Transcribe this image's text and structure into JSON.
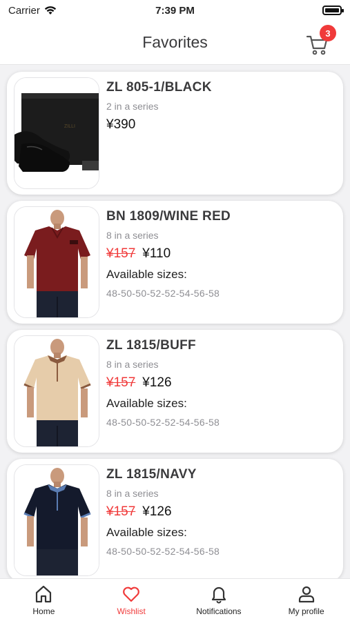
{
  "status_bar": {
    "carrier": "Carrier",
    "time": "7:39 PM"
  },
  "header": {
    "title": "Favorites",
    "cart_count": "3"
  },
  "products": [
    {
      "name": "ZL 805-1/BLACK",
      "series": "2 in a series",
      "price": "¥390",
      "old_price": null,
      "sizes_label": null,
      "sizes": null
    },
    {
      "name": "BN 1809/WINE RED",
      "series": "8 in a series",
      "price": "¥110",
      "old_price": "¥157",
      "sizes_label": "Available sizes:",
      "sizes": "48-50-50-52-52-54-56-58"
    },
    {
      "name": "ZL 1815/BUFF",
      "series": "8 in a series",
      "price": "¥126",
      "old_price": "¥157",
      "sizes_label": "Available sizes:",
      "sizes": "48-50-50-52-52-54-56-58"
    },
    {
      "name": "ZL 1815/NAVY",
      "series": "8 in a series",
      "price": "¥126",
      "old_price": "¥157",
      "sizes_label": "Available sizes:",
      "sizes": "48-50-50-52-52-54-56-58"
    }
  ],
  "tabbar": {
    "home": "Home",
    "wishlist": "Wishlist",
    "notifications": "Notifications",
    "profile": "My profile"
  },
  "colors": {
    "accent": "#f03a3a",
    "text": "#3a3a3c",
    "muted": "#8e8e93"
  }
}
